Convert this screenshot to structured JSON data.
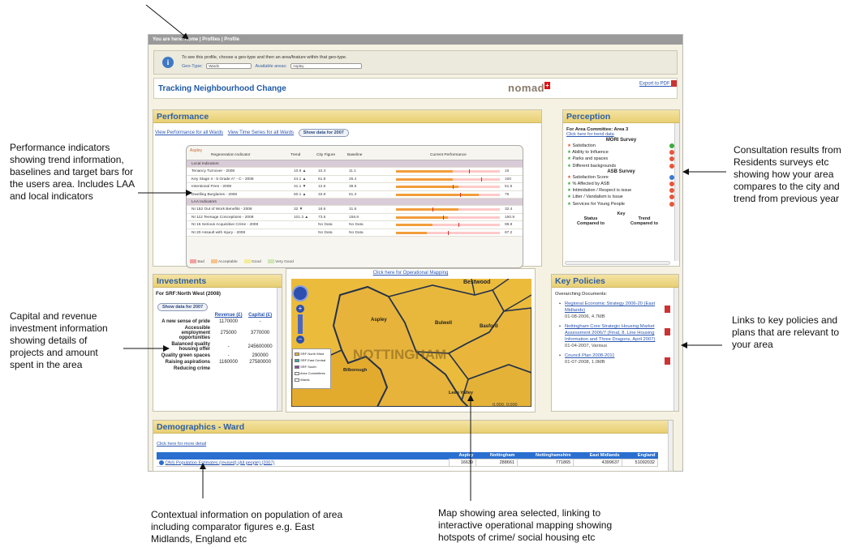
{
  "app": {
    "breadcrumb": "You are here: Home | Profiles | Profile",
    "info_line": "To see this profile, choose a geo-type and then an area/feature within that geo-type.",
    "geotype_label": "Geo-Type:",
    "geotype_value": "Wards",
    "areas_label": "Available areas:",
    "areas_value": "Aspley",
    "title": "Tracking Neighbourhood Change",
    "logo": "nomad",
    "logo_mark": "+",
    "export": "Export to PDF"
  },
  "performance": {
    "title": "Performance",
    "link1": "View Performance for all Wards",
    "link2": "View Time Series for all Wards",
    "button": "Show data for 2007",
    "area": "Aspley",
    "cols": [
      "Regeneration Indicator",
      "Trend",
      "City Figure",
      "Baseline",
      "Current Performance"
    ],
    "cat_local": "Local Indicators",
    "cat_laa": "LAA Indicators",
    "rows": [
      {
        "name": "Tenancy Turnover - 2008",
        "trend": "10.9 ▲",
        "city": "10.3",
        "base": "11.1",
        "val": "15",
        "fill": 0.55,
        "target": 0.7
      },
      {
        "name": "Key Stage 4 - 5 Grade A* - C - 2008",
        "trend": "44.1 ▲",
        "city": "61.8",
        "base": "26.4",
        "val": "100",
        "fill": 0.55,
        "target": 0.82
      },
      {
        "name": "Intentional Fires - 2008",
        "trend": "31.1 ▼",
        "city": "12.6",
        "base": "38.5",
        "val": "51.5",
        "fill": 0.6,
        "target": 0.55
      },
      {
        "name": "Dwelling Burglaries - 2008",
        "trend": "60.1 ▲",
        "city": "33.9",
        "base": "81.3",
        "val": "75",
        "fill": 0.8,
        "target": 0.62
      },
      {
        "name": "NI 152 Out of Work Benefits - 2008",
        "trend": "32 ▼",
        "city": "18.6",
        "base": "31.6",
        "val": "32.4",
        "fill": 0.6,
        "target": 0.35
      },
      {
        "name": "NI 112 Teenage Conceptions - 2008",
        "trend": "101.3 ▲",
        "city": "73.5",
        "base": "158.8",
        "val": "150.9",
        "fill": 0.5,
        "target": 0.45
      },
      {
        "name": "NI 15 Serious Acquisitive Crime - 2008",
        "trend": "",
        "city": "No Data",
        "base": "No Data",
        "val": "98.8",
        "fill": 0.35,
        "target": 0.6
      },
      {
        "name": "NI 20 Assault with Injury - 2008",
        "trend": "",
        "city": "No Data",
        "base": "No Data",
        "val": "87.2",
        "fill": 0.3,
        "target": 0.5
      }
    ],
    "legend": [
      "Bad",
      "Acceptable",
      "Good",
      "Very Good"
    ],
    "legend_colors": [
      "#f2a0a0",
      "#f6c48b",
      "#f5ec9c",
      "#cfe7b4"
    ]
  },
  "perception": {
    "title": "Perception",
    "area_committee": "For Area Committee: Area 3",
    "trend_link": "Click here for trend data",
    "mori": "MORI Survey",
    "mori_items": [
      {
        "label": "Satisfaction",
        "dot": "#3caa3c"
      },
      {
        "label": "Ability to Influence",
        "dot": "#e8553a"
      },
      {
        "label": "Parks and spaces",
        "dot": "#e8553a"
      },
      {
        "label": "Different backgrounds",
        "dot": "#e8553a"
      }
    ],
    "asb": "ASB Survey",
    "asb_items": [
      {
        "label": "Satisfaction Score",
        "dot": "#3a78d0"
      },
      {
        "label": "% Affected by ASB",
        "dot": "#e8553a"
      },
      {
        "label": "Intimidation / Respect is issue",
        "dot": "#e8553a"
      },
      {
        "label": "Litter / Vandalism is Issue",
        "dot": "#e8553a"
      },
      {
        "label": "Services for Young People",
        "dot": "#e8553a"
      }
    ],
    "key": "Key",
    "status": "Status Compared to",
    "trend": "Trend Compared to"
  },
  "investments": {
    "title": "Investments",
    "area": "For SRF:North West (2008)",
    "button": "Show data for 2007",
    "col1": "Revenue (£)",
    "col2": "Capital (£)",
    "rows": [
      {
        "name": "A new sense of pride",
        "rev": "1170000",
        "cap": "-"
      },
      {
        "name": "Accessible employment opportunities",
        "rev": "275000",
        "cap": "3770000"
      },
      {
        "name": "Balanced quality housing offer",
        "rev": "-",
        "cap": "245600000"
      },
      {
        "name": "Quality green spaces",
        "rev": "-",
        "cap": "290000"
      },
      {
        "name": "Raising aspirations",
        "rev": "1160000",
        "cap": "27580000"
      },
      {
        "name": "Reducing crime",
        "rev": "",
        "cap": ""
      }
    ]
  },
  "map": {
    "link": "Click here for Operational Mapping",
    "labels": [
      "Bestwood",
      "Aspley",
      "Basford",
      "Bulwell",
      "Bilborough",
      "Leen Valley",
      "NOTTINGHAM"
    ],
    "legend": [
      "SRF North West",
      "SRF East Central",
      "SRF South",
      "Area Committees",
      "Wards"
    ],
    "legend_colors": [
      "#e8b53a",
      "#3aa6a0",
      "#8a4aa0",
      "#ffffff",
      "#ffffff"
    ],
    "scale": "0.000, 0.000"
  },
  "policies": {
    "title": "Key Policies",
    "intro": "Overarching Documents:",
    "items": [
      {
        "title": "Regional Economic Strategy 2006-20 (East Midlands)",
        "meta": "01-08-2006, 4.7MB"
      },
      {
        "title": "Nottingham Core Strategic Housing Market Assessment 2006/7 (Final, 8. Line Housing Information and Three Dragons, April 2007)",
        "meta": "01-04-2007, Various"
      },
      {
        "title": "Council Plan 2008-2011",
        "meta": "01-07-2008, 1.0MB"
      }
    ]
  },
  "demographics": {
    "title": "Demographics - Ward",
    "link": "Click here for more detail",
    "cols": [
      "Aspley",
      "Nottingham",
      "Nottinghamshire",
      "East Midlands",
      "England"
    ],
    "row_label": "ONS Population Estimates (revised) (All people) (2007)",
    "row_values": [
      "16639",
      "288661",
      "771865",
      "4399637",
      "51092032"
    ]
  },
  "annotations": {
    "performance": "Performance indicators showing trend information, baselines and target bars for the users area. Includes LAA and local indicators",
    "investment": "Capital and revenue investment information showing details of projects and amount spent in the area",
    "perception": "Consultation results from Residents surveys etc showing how your area compares to the city and trend from previous year",
    "policies": "Links to key policies and plans that are relevant to your area",
    "demographics": "Contextual information on population of area including comparator figures e.g. East Midlands, England etc",
    "map": "Map showing area selected, linking to interactive operational mapping showing hotspots of crime/ social housing etc"
  }
}
